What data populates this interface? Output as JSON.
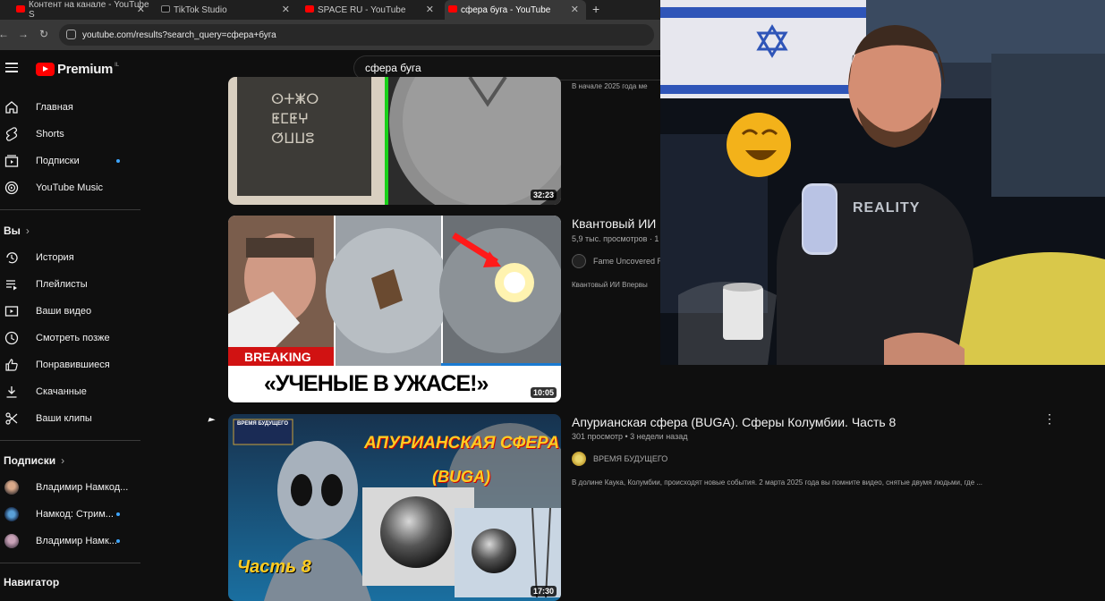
{
  "browser": {
    "tabs": [
      {
        "label": "Контент на канале - YouTube S",
        "icon": "youtube-icon"
      },
      {
        "label": "TikTok Studio",
        "icon": "tiktok-icon"
      },
      {
        "label": "SPACE RU - YouTube",
        "icon": "youtube-icon"
      },
      {
        "label": "сфера буга - YouTube",
        "icon": "youtube-icon"
      }
    ],
    "url": "youtube.com/results?search_query=сфера+буга"
  },
  "masthead": {
    "logo_text": "Premium",
    "logo_region": "IL",
    "search_value": "сфера буга"
  },
  "sidebar": {
    "main_items": [
      "Главная",
      "Shorts",
      "Подписки",
      "YouTube Music"
    ],
    "you_header": "Вы",
    "you_items": [
      "История",
      "Плейлисты",
      "Ваши видео",
      "Смотреть позже",
      "Понравившиеся",
      "Скачанные",
      "Ваши клипы"
    ],
    "subs_header": "Подписки",
    "subs_items": [
      "Владимир Намкод...",
      "Намкод: Стрим...",
      "Владимир Намк..."
    ],
    "navigator_header": "Навигатор"
  },
  "results": [
    {
      "duration": "32:23",
      "title": "",
      "meta": "",
      "channel": "",
      "desc": "В начале 2025 года ме"
    },
    {
      "duration": "10:05",
      "title": "Квантовый ИИ I",
      "meta": "5,9 тыс. просмотров · 1",
      "channel": "Fame Uncovered R",
      "desc": "Квантовый ИИ Впервы",
      "thumb_breaking": "BREAKING",
      "thumb_caption": "«УЧЕНЫЕ В УЖАСЕ!»"
    },
    {
      "duration": "17:30",
      "title": "Апурианская сфера (BUGA). Сферы Колумбии. Часть 8",
      "meta": "301 просмотр • 3 недели назад",
      "channel": "ВРЕМЯ БУДУЩЕГО",
      "desc": "В долине Каука, Колумбии, происходят новые события. 2 марта 2025 года вы помните видео, снятые двумя людьми, где ...",
      "thumb_heading": "АПУРИАНСКАЯ СФЕРА",
      "thumb_sub": "(BUGA)",
      "thumb_part": "Часть 8",
      "thumb_badge": "ВРЕМЯ БУДУЩЕГО"
    }
  ],
  "webcam": {
    "shirt_text": "REALITY"
  },
  "colors": {
    "brand": "#ff0000",
    "background": "#0f0f0f",
    "accent_dot": "#3ea6ff"
  }
}
